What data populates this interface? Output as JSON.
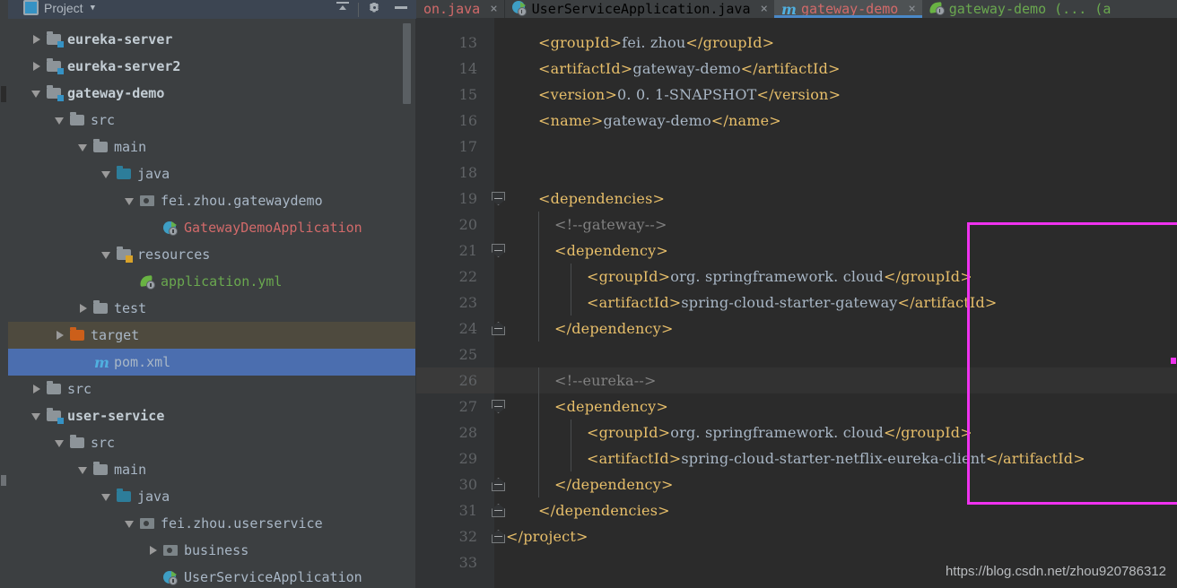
{
  "panel": {
    "title": "Project",
    "caret_glyph": "▼",
    "icons": [
      {
        "name": "collapse-all-icon",
        "label": "Collapse All"
      },
      {
        "name": "gear-icon",
        "label": "Settings"
      },
      {
        "name": "minimize-icon",
        "label": "Hide"
      }
    ],
    "tree": [
      {
        "label": "eureka-server",
        "indent": 0,
        "arrow": "closed",
        "icon": "module-folder",
        "style": "module"
      },
      {
        "label": "eureka-server2",
        "indent": 0,
        "arrow": "closed",
        "icon": "module-folder",
        "style": "module"
      },
      {
        "label": "gateway-demo",
        "indent": 0,
        "arrow": "open",
        "icon": "module-folder",
        "style": "module"
      },
      {
        "label": "src",
        "indent": 1,
        "arrow": "open",
        "icon": "folder",
        "style": "plain"
      },
      {
        "label": "main",
        "indent": 2,
        "arrow": "open",
        "icon": "folder",
        "style": "plain"
      },
      {
        "label": "java",
        "indent": 3,
        "arrow": "open",
        "icon": "source-folder",
        "style": "plain"
      },
      {
        "label": "fei.zhou.gatewaydemo",
        "indent": 4,
        "arrow": "open",
        "icon": "package",
        "style": "plain"
      },
      {
        "label": "GatewayDemoApplication",
        "indent": 5,
        "arrow": "none",
        "icon": "spring-boot-class",
        "style": "class"
      },
      {
        "label": "resources",
        "indent": 3,
        "arrow": "open",
        "icon": "resources-folder",
        "style": "plain"
      },
      {
        "label": "application.yml",
        "indent": 4,
        "arrow": "none",
        "icon": "spring-leaf",
        "style": "yml"
      },
      {
        "label": "test",
        "indent": 2,
        "arrow": "closed",
        "icon": "folder",
        "style": "plain"
      },
      {
        "label": "target",
        "indent": 1,
        "arrow": "closed",
        "icon": "target-folder",
        "style": "plain",
        "row": "hl"
      },
      {
        "label": "pom.xml",
        "indent": 2,
        "arrow": "none",
        "icon": "maven-m",
        "style": "pom",
        "row": "sel"
      },
      {
        "label": "src",
        "indent": 0,
        "arrow": "closed",
        "icon": "folder",
        "style": "plain"
      },
      {
        "label": "user-service",
        "indent": 0,
        "arrow": "open",
        "icon": "module-folder",
        "style": "module"
      },
      {
        "label": "src",
        "indent": 1,
        "arrow": "open",
        "icon": "folder",
        "style": "plain"
      },
      {
        "label": "main",
        "indent": 2,
        "arrow": "open",
        "icon": "folder",
        "style": "plain"
      },
      {
        "label": "java",
        "indent": 3,
        "arrow": "open",
        "icon": "source-folder",
        "style": "plain"
      },
      {
        "label": "fei.zhou.userservice",
        "indent": 4,
        "arrow": "open",
        "icon": "package",
        "style": "plain"
      },
      {
        "label": "business",
        "indent": 5,
        "arrow": "closed",
        "icon": "package",
        "style": "plain"
      },
      {
        "label": "UserServiceApplication",
        "indent": 5,
        "arrow": "none",
        "icon": "spring-boot-class",
        "style": "plain"
      }
    ]
  },
  "editor": {
    "tabs": [
      {
        "label": "on.java",
        "icon": "none",
        "color": "red",
        "active": false,
        "close": "×"
      },
      {
        "label": "UserServiceApplication.java",
        "icon": "spring-boot-class",
        "color": "plain",
        "active": false,
        "close": "×"
      },
      {
        "label": "gateway-demo",
        "icon": "maven-m",
        "color": "red",
        "active": true,
        "close": "×"
      },
      {
        "label": "gateway-demo (... (a",
        "icon": "spring-leaf",
        "color": "green",
        "active": false,
        "close": ""
      }
    ],
    "lines": [
      {
        "num": "13",
        "indent": 2,
        "segs": [
          {
            "t": "<",
            "c": "br"
          },
          {
            "t": "groupId",
            "c": "tag"
          },
          {
            "t": ">",
            "c": "br"
          },
          {
            "t": "fei. zhou",
            "c": "txt"
          },
          {
            "t": "</",
            "c": "br"
          },
          {
            "t": "groupId",
            "c": "tag"
          },
          {
            "t": ">",
            "c": "br"
          }
        ]
      },
      {
        "num": "14",
        "indent": 2,
        "segs": [
          {
            "t": "<",
            "c": "br"
          },
          {
            "t": "artifactId",
            "c": "tag"
          },
          {
            "t": ">",
            "c": "br"
          },
          {
            "t": "gateway-demo",
            "c": "txt"
          },
          {
            "t": "</",
            "c": "br"
          },
          {
            "t": "artifactId",
            "c": "tag"
          },
          {
            "t": ">",
            "c": "br"
          }
        ]
      },
      {
        "num": "15",
        "indent": 2,
        "segs": [
          {
            "t": "<",
            "c": "br"
          },
          {
            "t": "version",
            "c": "tag"
          },
          {
            "t": ">",
            "c": "br"
          },
          {
            "t": "0. 0. 1-SNAPSHOT",
            "c": "txt"
          },
          {
            "t": "</",
            "c": "br"
          },
          {
            "t": "version",
            "c": "tag"
          },
          {
            "t": ">",
            "c": "br"
          }
        ]
      },
      {
        "num": "16",
        "indent": 2,
        "segs": [
          {
            "t": "<",
            "c": "br"
          },
          {
            "t": "name",
            "c": "tag"
          },
          {
            "t": ">",
            "c": "br"
          },
          {
            "t": "gateway-demo",
            "c": "txt"
          },
          {
            "t": "</",
            "c": "br"
          },
          {
            "t": "name",
            "c": "tag"
          },
          {
            "t": ">",
            "c": "br"
          }
        ]
      },
      {
        "num": "17",
        "indent": 0,
        "segs": []
      },
      {
        "num": "18",
        "indent": 0,
        "segs": []
      },
      {
        "num": "19",
        "indent": 2,
        "segs": [
          {
            "t": "<",
            "c": "br"
          },
          {
            "t": "dependencies",
            "c": "tag"
          },
          {
            "t": ">",
            "c": "br"
          }
        ]
      },
      {
        "num": "20",
        "indent": 3,
        "segs": [
          {
            "t": "<!--gateway-->",
            "c": "cmt"
          }
        ]
      },
      {
        "num": "21",
        "indent": 3,
        "segs": [
          {
            "t": "<",
            "c": "br"
          },
          {
            "t": "dependency",
            "c": "tag"
          },
          {
            "t": ">",
            "c": "br"
          }
        ]
      },
      {
        "num": "22",
        "indent": 5,
        "segs": [
          {
            "t": "<",
            "c": "br"
          },
          {
            "t": "groupId",
            "c": "tag"
          },
          {
            "t": ">",
            "c": "br"
          },
          {
            "t": "org. springframework. cloud",
            "c": "txt"
          },
          {
            "t": "</",
            "c": "br"
          },
          {
            "t": "groupId",
            "c": "tag"
          },
          {
            "t": ">",
            "c": "br"
          }
        ]
      },
      {
        "num": "23",
        "indent": 5,
        "segs": [
          {
            "t": "<",
            "c": "br"
          },
          {
            "t": "artifactId",
            "c": "tag"
          },
          {
            "t": ">",
            "c": "br"
          },
          {
            "t": "spring-cloud-starter-gateway",
            "c": "txt"
          },
          {
            "t": "</",
            "c": "br"
          },
          {
            "t": "artifactId",
            "c": "tag"
          },
          {
            "t": ">",
            "c": "br"
          }
        ]
      },
      {
        "num": "24",
        "indent": 3,
        "segs": [
          {
            "t": "</",
            "c": "br"
          },
          {
            "t": "dependency",
            "c": "tag"
          },
          {
            "t": ">",
            "c": "br"
          }
        ]
      },
      {
        "num": "25",
        "indent": 0,
        "segs": []
      },
      {
        "num": "26",
        "indent": 3,
        "segs": [
          {
            "t": "<!--eureka-->",
            "c": "cmt"
          }
        ],
        "current": true
      },
      {
        "num": "27",
        "indent": 3,
        "segs": [
          {
            "t": "<",
            "c": "br"
          },
          {
            "t": "dependency",
            "c": "tag"
          },
          {
            "t": ">",
            "c": "br"
          }
        ]
      },
      {
        "num": "28",
        "indent": 5,
        "segs": [
          {
            "t": "<",
            "c": "br"
          },
          {
            "t": "groupId",
            "c": "tag"
          },
          {
            "t": ">",
            "c": "br"
          },
          {
            "t": "org. springframework. cloud",
            "c": "txt"
          },
          {
            "t": "</",
            "c": "br"
          },
          {
            "t": "groupId",
            "c": "tag"
          },
          {
            "t": ">",
            "c": "br"
          }
        ]
      },
      {
        "num": "29",
        "indent": 5,
        "segs": [
          {
            "t": "<",
            "c": "br"
          },
          {
            "t": "artifactId",
            "c": "tag"
          },
          {
            "t": ">",
            "c": "br"
          },
          {
            "t": "spring-cloud-starter-netflix-eureka-client",
            "c": "txt"
          },
          {
            "t": "</",
            "c": "br"
          },
          {
            "t": "artifactId",
            "c": "tag"
          },
          {
            "t": ">",
            "c": "br"
          }
        ]
      },
      {
        "num": "30",
        "indent": 3,
        "segs": [
          {
            "t": "</",
            "c": "br"
          },
          {
            "t": "dependency",
            "c": "tag"
          },
          {
            "t": ">",
            "c": "br"
          }
        ]
      },
      {
        "num": "31",
        "indent": 2,
        "segs": [
          {
            "t": "</",
            "c": "br"
          },
          {
            "t": "dependencies",
            "c": "tag"
          },
          {
            "t": ">",
            "c": "br"
          }
        ]
      },
      {
        "num": "32",
        "indent": 0,
        "segs": [
          {
            "t": "</",
            "c": "br"
          },
          {
            "t": "project",
            "c": "tag"
          },
          {
            "t": ">",
            "c": "br"
          }
        ]
      },
      {
        "num": "33",
        "indent": 0,
        "segs": []
      }
    ],
    "fold_markers": [
      {
        "line": "19",
        "dir": "down"
      },
      {
        "line": "21",
        "dir": "down"
      },
      {
        "line": "24",
        "dir": "up"
      },
      {
        "line": "27",
        "dir": "down"
      },
      {
        "line": "30",
        "dir": "up"
      },
      {
        "line": "31",
        "dir": "up"
      },
      {
        "line": "32",
        "dir": "up"
      }
    ],
    "highlight_box_color": "#ef32ef"
  },
  "watermark": "https://blog.csdn.net/zhou920786312"
}
